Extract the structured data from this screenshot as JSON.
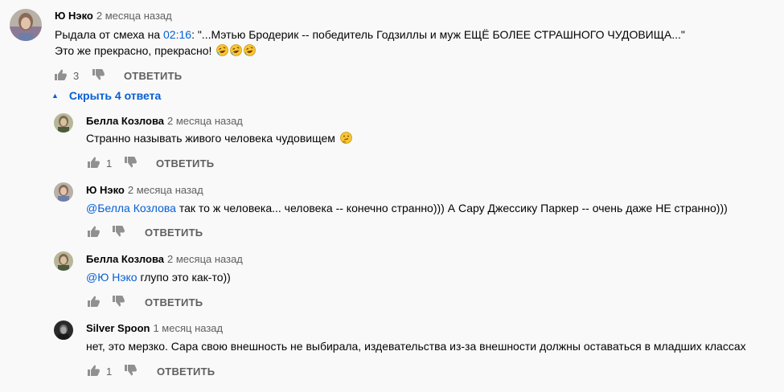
{
  "comments": [
    {
      "author": "Ю Нэко",
      "date": "2 месяца назад",
      "text_before": "Рыдала от смеха на ",
      "timestamp": "02:16",
      "text_after": ": \"...Мэтью Бродерик -- победитель Годзиллы и муж ЕЩЁ БОЛЕЕ СТРАШНОГО ЧУДОВИЩА...\"",
      "line2": "Это же прекрасно, прекрасно!",
      "emoji": [
        "rofl-emoji",
        "rofl-emoji",
        "rofl-emoji"
      ],
      "likes": "3",
      "reply_label": "ОТВЕТИТЬ"
    }
  ],
  "hide_replies": {
    "label": "Скрыть 4 ответа"
  },
  "replies": [
    {
      "author": "Белла Козлова",
      "date": "2 месяца назад",
      "text": "Странно называть живого человека чудовищем",
      "emoji": "thinking-emoji",
      "likes": "1",
      "reply_label": "ОТВЕТИТЬ"
    },
    {
      "author": "Ю Нэко",
      "date": "2 месяца назад",
      "mention": "@Белла Козлова",
      "text": " так то ж человека... человека -- конечно странно))) А Сару Джессику Паркер -- очень даже НЕ странно)))",
      "reply_label": "ОТВЕТИТЬ"
    },
    {
      "author": "Белла Козлова",
      "date": "2 месяца назад",
      "mention": "@Ю Нэко",
      "text": " глупо это как-то))",
      "reply_label": "ОТВЕТИТЬ"
    },
    {
      "author": "Silver Spoon",
      "date": "1 месяц назад",
      "text": "нет, это мерзко. Сара свою внешность не выбирала, издевательства из-за внешности должны оставаться в младших классах",
      "likes": "1",
      "reply_label": "ОТВЕТИТЬ"
    }
  ],
  "colors": {
    "link": "#065fd4",
    "secondary": "#606060",
    "background": "#f9f9f9"
  }
}
